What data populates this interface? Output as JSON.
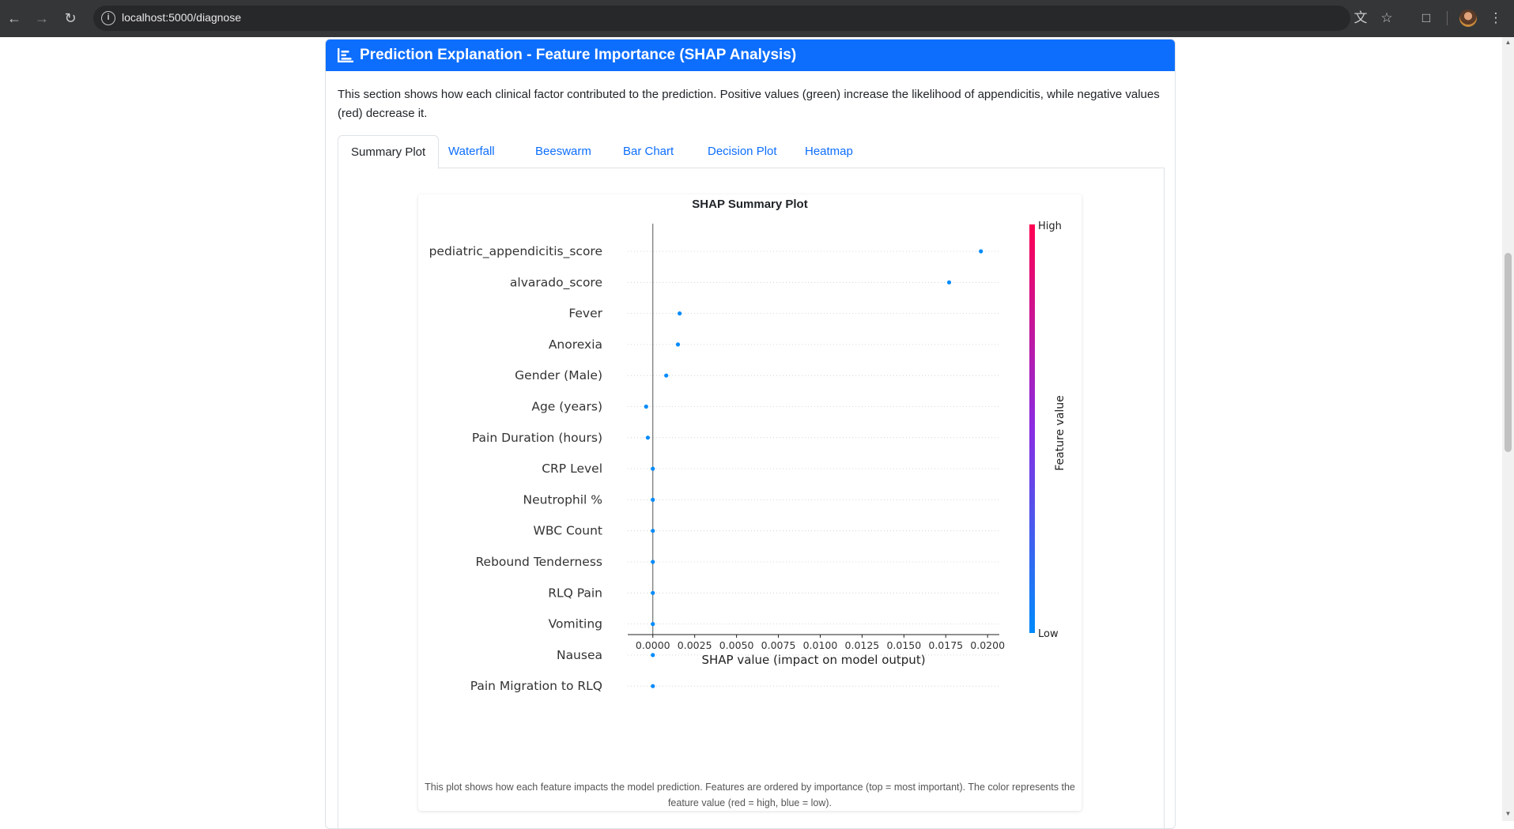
{
  "browser": {
    "url": "localhost:5000/diagnose"
  },
  "card": {
    "title": "Prediction Explanation - Feature Importance (SHAP Analysis)",
    "description": "This section shows how each clinical factor contributed to the prediction. Positive values (green) increase the likelihood of appendicitis, while negative values (red) decrease it."
  },
  "tabs": [
    {
      "label": "Summary Plot",
      "active": true
    },
    {
      "label": "Waterfall",
      "active": false
    },
    {
      "label": "Beeswarm",
      "active": false
    },
    {
      "label": "Bar Chart",
      "active": false
    },
    {
      "label": "Decision Plot",
      "active": false
    },
    {
      "label": "Heatmap",
      "active": false
    }
  ],
  "plot": {
    "title": "SHAP Summary Plot",
    "caption": "This plot shows how each feature impacts the model prediction. Features are ordered by importance (top = most important). The color represents the feature value (red = high, blue = low)."
  },
  "colors": {
    "primary": "#0d6efd",
    "point_low": "#008bfb",
    "point_high": "#ff0052",
    "colorbar_mid": "#8a2be2"
  },
  "chart_data": {
    "type": "scatter",
    "xlabel": "SHAP value (impact on model output)",
    "ylabel": "",
    "xlim": [
      -0.0015,
      0.0207
    ],
    "xticks": [
      "0.0000",
      "0.0025",
      "0.0050",
      "0.0075",
      "0.0100",
      "0.0125",
      "0.0150",
      "0.0175",
      "0.0200"
    ],
    "xtick_values": [
      0,
      0.0025,
      0.005,
      0.0075,
      0.01,
      0.0125,
      0.015,
      0.0175,
      0.02
    ],
    "grid": "horizontal dashed per feature",
    "colorbar": {
      "label": "Feature value",
      "high": "High",
      "low": "Low"
    },
    "features": [
      {
        "name": "pediatric_appendicitis_score",
        "value": 0.0196,
        "feature_value": "low"
      },
      {
        "name": "alvarado_score",
        "value": 0.0177,
        "feature_value": "low"
      },
      {
        "name": "Fever",
        "value": 0.0016,
        "feature_value": "low"
      },
      {
        "name": "Anorexia",
        "value": 0.0015,
        "feature_value": "low"
      },
      {
        "name": "Gender (Male)",
        "value": 0.0008,
        "feature_value": "low"
      },
      {
        "name": "Age (years)",
        "value": -0.0004,
        "feature_value": "low"
      },
      {
        "name": "Pain Duration (hours)",
        "value": -0.0003,
        "feature_value": "low"
      },
      {
        "name": "CRP Level",
        "value": 0.0,
        "feature_value": "low"
      },
      {
        "name": "Neutrophil %",
        "value": 0.0,
        "feature_value": "low"
      },
      {
        "name": "WBC Count",
        "value": 0.0,
        "feature_value": "low"
      },
      {
        "name": "Rebound Tenderness",
        "value": 0.0,
        "feature_value": "low"
      },
      {
        "name": "RLQ Pain",
        "value": 0.0,
        "feature_value": "low"
      },
      {
        "name": "Vomiting",
        "value": 0.0,
        "feature_value": "low"
      },
      {
        "name": "Nausea",
        "value": 0.0,
        "feature_value": "low"
      },
      {
        "name": "Pain Migration to RLQ",
        "value": 0.0,
        "feature_value": "low"
      }
    ]
  }
}
